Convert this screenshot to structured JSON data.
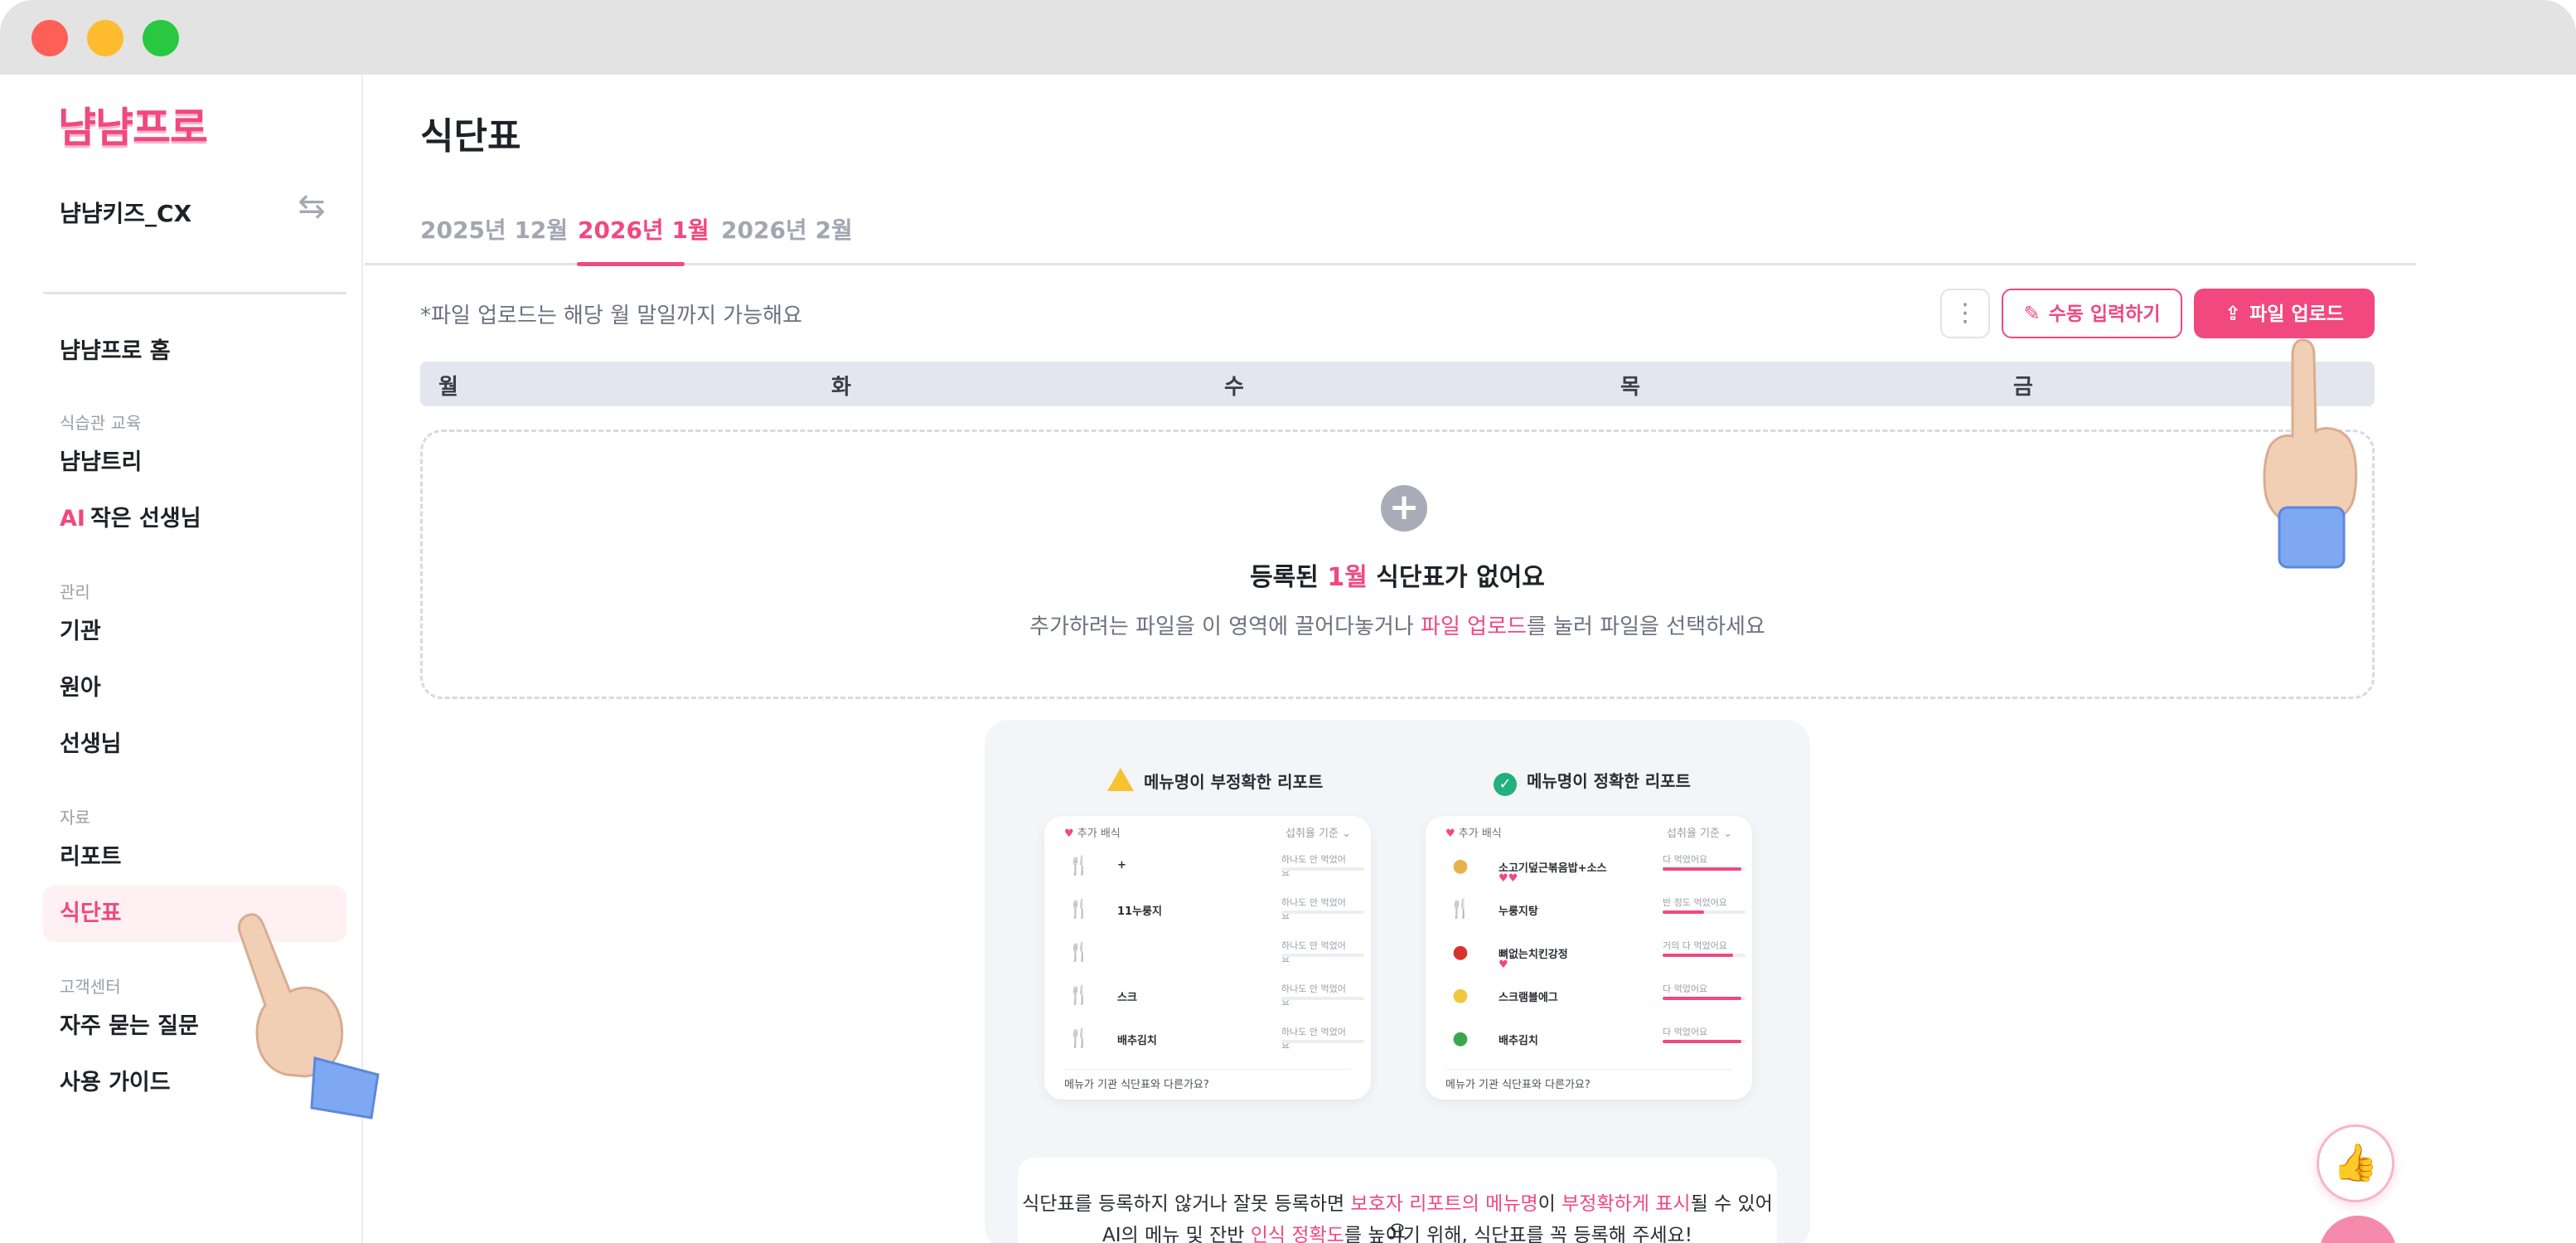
{
  "window": {
    "controls": [
      "close",
      "minimize",
      "maximize"
    ]
  },
  "sidebar": {
    "logo": "냠냠프로",
    "org_name": "냠냠키즈_CX",
    "switch_icon": "swap-icon",
    "home": "냠냠프로 홈",
    "sections": [
      {
        "title": "식습관 교육",
        "items": [
          "냠냠트리",
          "작은 선생님"
        ]
      },
      {
        "title": "관리",
        "items": [
          "기관",
          "원아",
          "선생님"
        ]
      },
      {
        "title": "자료",
        "items": [
          "리포트",
          "식단표"
        ]
      },
      {
        "title": "고객센터",
        "items": [
          "자주 묻는 질문",
          "사용 가이드"
        ]
      }
    ],
    "ai_badge": "AI",
    "active_item": "식단표"
  },
  "main": {
    "title": "식단표",
    "tabs": [
      {
        "label": "2025년 12월",
        "active": false
      },
      {
        "label": "2026년 1월",
        "active": true
      },
      {
        "label": "2026년 2월",
        "active": false
      }
    ],
    "notice": "*파일 업로드는 해당 월 말일까지 가능해요",
    "more_icon": "⋮",
    "manual_button": "수동 입력하기",
    "upload_button": "파일 업로드",
    "weekdays": [
      "월",
      "화",
      "수",
      "목",
      "금"
    ],
    "empty": {
      "title_pre": "등록된 ",
      "title_month": "1월",
      "title_post": " 식단표가 없어요",
      "sub_pre": "추가하려는 파일을 이 영역에 끌어다놓거나 ",
      "sub_link": "파일 업로드",
      "sub_post": "를 눌러 파일을 선택하세요"
    }
  },
  "compare": {
    "bad_title": "메뉴명이 부정확한 리포트",
    "good_title": "메뉴명이 정확한 리포트",
    "card_header": "추가 배식",
    "card_header_right": "섭취율 기준",
    "card_footer": "메뉴가 기관 식단표와 다른가요?",
    "bad_rows": [
      {
        "name": "+",
        "stat": "하나도 안 먹었어요"
      },
      {
        "name": "11누룽지",
        "stat": "하나도 안 먹었어요"
      },
      {
        "name": "",
        "stat": "하나도 안 먹었어요"
      },
      {
        "name": "스크",
        "stat": "하나도 안 먹었어요"
      },
      {
        "name": "배추김치",
        "stat": "하나도 안 먹었어요"
      }
    ],
    "good_rows": [
      {
        "name": "소고기덮근볶음밥+소스",
        "stat": "다 먹었어요",
        "fill": 0.95
      },
      {
        "name": "누룽지탕",
        "stat": "반 정도 먹었어요",
        "fill": 0.5
      },
      {
        "name": "뼈없는치킨강정",
        "stat": "거의 다 먹었어요",
        "fill": 0.85
      },
      {
        "name": "스크램블에그",
        "stat": "다 먹었어요",
        "fill": 0.95
      },
      {
        "name": "배추김치",
        "stat": "다 먹었어요",
        "fill": 0.95
      }
    ],
    "explain_l1_pre": "식단표를 등록하지 않거나 잘못 등록하면 ",
    "explain_l1_link1": "보호자 리포트의 메뉴명",
    "explain_l1_mid": "이 ",
    "explain_l1_link2": "부정확하게 표시",
    "explain_l1_post": "될 수 있어요",
    "explain_l2_pre": "AI의 메뉴 및 잔반 ",
    "explain_l2_link": "인식 정확도",
    "explain_l2_post": "를 높이기 위해, 식단표를 꼭 등록해 주세요!"
  },
  "colors": {
    "accent": "#f0487f",
    "bg": "#ffffff",
    "muted": "#a3a6b2"
  }
}
